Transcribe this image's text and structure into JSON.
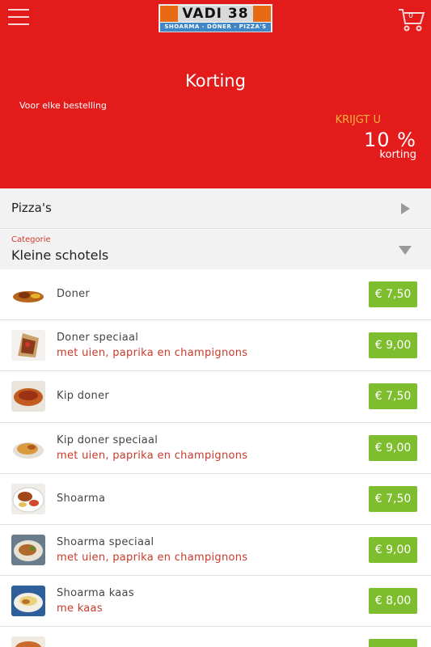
{
  "header": {
    "logo_title": "VADI 38",
    "logo_subtitle": "SHOARMA - DÖNER - PIZZA'S",
    "cart_count": "0",
    "icons": {
      "menu": "hamburger-icon",
      "cart": "cart-icon"
    },
    "colors": {
      "bar": "#e31b1b"
    }
  },
  "promo": {
    "title": "Korting",
    "subtitle": "Voor elke bestelling",
    "krijgt": "KRIJGT U",
    "percent": "10 %",
    "korting": "korting"
  },
  "category": {
    "label": "Pizza's",
    "icon": "triangle-right-icon"
  },
  "subcategory": {
    "caption": "Categorie",
    "label": "Kleine schotels",
    "icon": "triangle-down-icon"
  },
  "colors": {
    "price_bg": "#7dbd2e",
    "desc_text": "#c93a2b",
    "accent_orange": "#f7b23b"
  },
  "items": [
    {
      "name": "Doner",
      "desc": "",
      "price": "€ 7,50"
    },
    {
      "name": "Doner speciaal",
      "desc": "met uien, paprika en champignons",
      "price": "€ 9,00"
    },
    {
      "name": "Kip doner",
      "desc": "",
      "price": "€ 7,50"
    },
    {
      "name": "Kip doner speciaal",
      "desc": "met uien, paprika en champignons",
      "price": "€ 9,00"
    },
    {
      "name": "Shoarma",
      "desc": "",
      "price": "€ 7,50"
    },
    {
      "name": "Shoarma speciaal",
      "desc": "met uien, paprika en champignons",
      "price": "€ 9,00"
    },
    {
      "name": "Shoarma kaas",
      "desc": "me kaas",
      "price": "€ 8,00"
    },
    {
      "name": "",
      "desc": "",
      "price": ""
    }
  ]
}
